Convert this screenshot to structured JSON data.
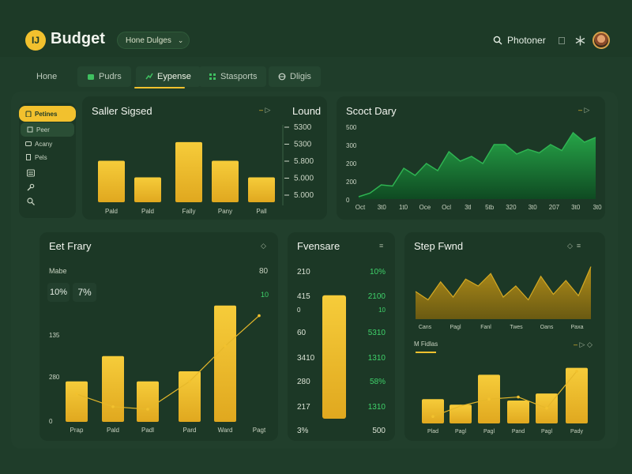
{
  "colors": {
    "background": "#1f3d2a",
    "card": "#1c3826",
    "accent_yellow": "#f2c12e",
    "accent_green": "#3fd16a"
  },
  "header": {
    "logo_text": "IJ",
    "brand": "Budget",
    "workspace_select": "Hone Dulges",
    "search_label": "Photoner",
    "icons": [
      "search-icon",
      "apple-icon",
      "asterisk-icon"
    ]
  },
  "tabs": [
    {
      "label": "Hone",
      "icon": ""
    },
    {
      "label": "Pudrs",
      "icon": "wallet-icon"
    },
    {
      "label": "Eypense",
      "icon": "trend-icon"
    },
    {
      "label": "Stasports",
      "icon": "grid-icon"
    },
    {
      "label": "Dligis",
      "icon": "globe-icon"
    }
  ],
  "sidebar": {
    "items": [
      {
        "label": "Petines",
        "icon": "clipboard-icon",
        "state": "active"
      },
      {
        "label": "Peer",
        "icon": "box-icon",
        "state": "hover"
      },
      {
        "label": "Acany",
        "icon": "card-icon",
        "state": ""
      },
      {
        "label": "Pels",
        "icon": "doc-icon",
        "state": ""
      }
    ],
    "icon_buttons": [
      "list-icon",
      "wrench-icon",
      "search-icon"
    ]
  },
  "cards": {
    "salary": {
      "title": "Saller Sigsed",
      "legend": "Lound"
    },
    "stock": {
      "title": "Scoct Dary"
    },
    "best": {
      "title": "Eet Frary",
      "row_label": "Mabe",
      "row_value": "80",
      "stat1": "10%",
      "stat2": "7%",
      "stat_right": "10"
    },
    "expense": {
      "title": "Fvensare"
    },
    "step": {
      "title": "Step Fwnd",
      "sub_title": "M Fidlas"
    }
  },
  "chart_data": [
    {
      "type": "bar",
      "title": "Saller Sigsed",
      "categories": [
        "Pald",
        "Pald",
        "Fally",
        "Pany",
        "Pall"
      ],
      "values": [
        5200,
        5120,
        5290,
        5200,
        5120
      ],
      "legend": "Lound",
      "y_ticks": [
        "5300",
        "5300",
        "5.800",
        "5.000",
        "5.000"
      ],
      "ylim": [
        5000,
        5320
      ]
    },
    {
      "type": "area",
      "title": "Scoct Dary",
      "x": [
        "Oct",
        "3t0",
        "1t0",
        "Oce",
        "Ocl",
        "3tl",
        "5tb",
        "320",
        "3t0",
        "207",
        "3t0",
        "3t0"
      ],
      "y_ticks": [
        "500",
        "300",
        "200",
        "200",
        "0"
      ],
      "values": [
        10,
        25,
        60,
        55,
        130,
        100,
        150,
        120,
        200,
        160,
        180,
        150,
        230,
        230,
        190,
        210,
        195,
        230,
        205,
        280,
        240,
        260
      ],
      "ylim": [
        0,
        300
      ]
    },
    {
      "type": "bar",
      "title": "Eet Frary",
      "categories": [
        "Prap",
        "Pald",
        "Padl",
        "Pard",
        "Ward",
        "Pagt"
      ],
      "values": [
        80,
        130,
        80,
        100,
        230,
        null
      ],
      "line": [
        55,
        30,
        25,
        80,
        150,
        210
      ],
      "y_ticks": [
        "135",
        "280",
        "0"
      ],
      "ylim": [
        0,
        250
      ]
    },
    {
      "type": "bar",
      "title": "Fvensare",
      "left_labels": [
        "210",
        "415",
        "0",
        "60",
        "3410",
        "280",
        "217",
        "3%"
      ],
      "right_labels": [
        "10%",
        "2100",
        "10",
        "5310",
        "1310",
        "58%",
        "1310",
        "500"
      ],
      "values": [
        0.93
      ],
      "ylim": [
        0,
        1
      ]
    },
    {
      "type": "area",
      "title": "Step Fwnd",
      "x": [
        "Cans",
        "Pagl",
        "Fanl",
        "Twes",
        "Oans",
        "Paxa"
      ],
      "values": [
        40,
        34,
        47,
        36,
        49,
        44,
        53,
        36,
        44,
        34,
        51,
        38,
        48,
        37,
        58
      ],
      "ylim": [
        0,
        60
      ]
    },
    {
      "type": "bar",
      "title": "M Fidlas",
      "categories": [
        "Plad",
        "Pagl",
        "Pagl",
        "Pand",
        "Pagl",
        "Pady"
      ],
      "values": [
        35,
        27,
        70,
        33,
        43,
        80
      ],
      "line": [
        10,
        25,
        35,
        38,
        22,
        75
      ],
      "ylim": [
        0,
        100
      ]
    }
  ]
}
